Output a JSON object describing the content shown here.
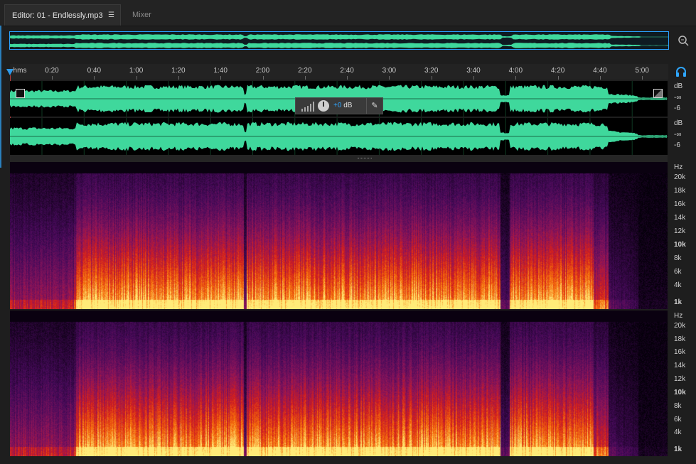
{
  "tabs": [
    {
      "label": "Editor: 01 - Endlessly.mp3",
      "active": true,
      "menu_icon": "hamburger-icon"
    },
    {
      "label": "Mixer",
      "active": false
    }
  ],
  "ruler": {
    "unit_label": "hms",
    "ticks": [
      "0:20",
      "0:40",
      "1:00",
      "1:20",
      "1:40",
      "2:00",
      "2:20",
      "2:40",
      "3:00",
      "3:20",
      "3:40",
      "4:00",
      "4:20",
      "4:40",
      "5:00"
    ]
  },
  "waveform": {
    "color": "#3fd89c",
    "channels": [
      {
        "scale": [
          "dB",
          "-∞",
          "-6"
        ]
      },
      {
        "scale": [
          "dB",
          "-∞",
          "-6"
        ]
      }
    ]
  },
  "hud": {
    "gain_value": "+0",
    "gain_unit": "dB"
  },
  "spectral": {
    "channels": [
      {
        "scale": [
          "Hz",
          "20k",
          "18k",
          "16k",
          "14k",
          "12k",
          "10k",
          "8k",
          "6k",
          "4k",
          "1k"
        ]
      },
      {
        "scale": [
          "Hz",
          "20k",
          "18k",
          "16k",
          "14k",
          "12k",
          "10k",
          "8k",
          "6k",
          "4k",
          "1k"
        ]
      }
    ]
  },
  "colors": {
    "accent": "#2aa1ff",
    "playhead": "#b83a3a"
  }
}
